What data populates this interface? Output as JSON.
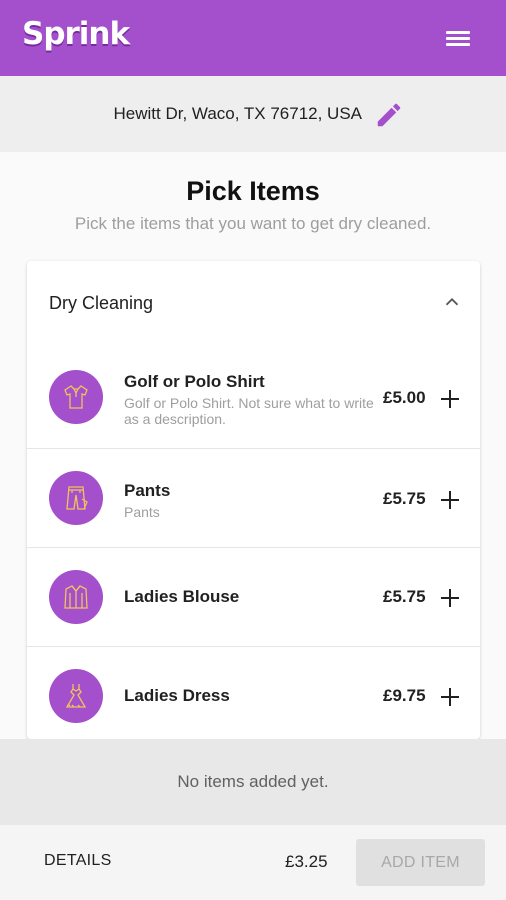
{
  "app": {
    "logo_text": "Sprink",
    "brand_color": "#a44fcb"
  },
  "header": {
    "menu_icon": "hamburger-menu-icon"
  },
  "address": {
    "text": "Hewitt Dr, Waco, TX 76712, USA",
    "edit_icon": "pencil-edit-icon"
  },
  "page": {
    "title": "Pick Items",
    "subtitle": "Pick the items that you want to get dry cleaned."
  },
  "category": {
    "title": "Dry Cleaning",
    "toggle_icon": "chevron-up-icon",
    "items": [
      {
        "name": "Golf or Polo Shirt",
        "description": "Golf or Polo Shirt. Not sure what to write as a description.",
        "price": "£5.00",
        "icon": "polo-shirt-icon"
      },
      {
        "name": "Pants",
        "description": "Pants",
        "price": "£5.75",
        "icon": "pants-icon"
      },
      {
        "name": "Ladies Blouse",
        "description": "",
        "price": "£5.75",
        "icon": "blouse-icon"
      },
      {
        "name": "Ladies Dress",
        "description": "",
        "price": "£9.75",
        "icon": "dress-icon"
      }
    ]
  },
  "cart": {
    "empty_text": "No items added yet."
  },
  "footer": {
    "details_label": "DETAILS",
    "total": "£3.25",
    "add_item_label": "ADD ITEM"
  }
}
